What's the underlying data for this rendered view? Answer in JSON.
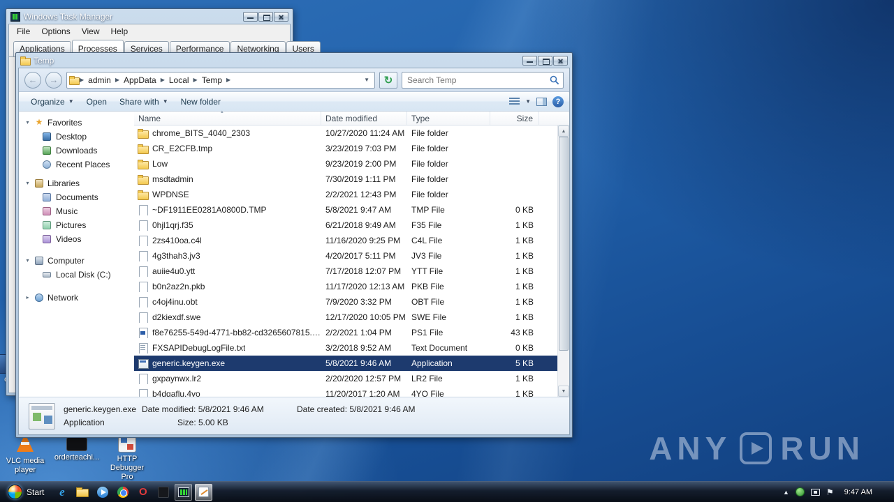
{
  "task_manager": {
    "title": "Windows Task Manager",
    "menu": [
      "File",
      "Options",
      "View",
      "Help"
    ],
    "tabs": [
      "Applications",
      "Processes",
      "Services",
      "Performance",
      "Networking",
      "Users"
    ],
    "active_tab": "Processes"
  },
  "explorer": {
    "title": "Temp",
    "breadcrumb": [
      "admin",
      "AppData",
      "Local",
      "Temp"
    ],
    "search_placeholder": "Search Temp",
    "toolbar": {
      "organize": "Organize",
      "open": "Open",
      "share": "Share with",
      "new_folder": "New folder"
    },
    "sidebar": [
      {
        "section": "Favorites",
        "items": [
          "Desktop",
          "Downloads",
          "Recent Places"
        ]
      },
      {
        "section": "Libraries",
        "items": [
          "Documents",
          "Music",
          "Pictures",
          "Videos"
        ]
      },
      {
        "section": "Computer",
        "items": [
          "Local Disk (C:)"
        ]
      },
      {
        "section": "Network",
        "items": []
      }
    ],
    "columns": [
      "Name",
      "Date modified",
      "Type",
      "Size"
    ],
    "files": [
      {
        "name": "chrome_BITS_4040_2303",
        "date": "10/27/2020 11:24 AM",
        "type": "File folder",
        "size": "",
        "icon": "folder"
      },
      {
        "name": "CR_E2CFB.tmp",
        "date": "3/23/2019 7:03 PM",
        "type": "File folder",
        "size": "",
        "icon": "folder"
      },
      {
        "name": "Low",
        "date": "9/23/2019 2:00 PM",
        "type": "File folder",
        "size": "",
        "icon": "folder"
      },
      {
        "name": "msdtadmin",
        "date": "7/30/2019 1:11 PM",
        "type": "File folder",
        "size": "",
        "icon": "folder"
      },
      {
        "name": "WPDNSE",
        "date": "2/2/2021 12:43 PM",
        "type": "File folder",
        "size": "",
        "icon": "folder"
      },
      {
        "name": "~DF1911EE0281A0800D.TMP",
        "date": "5/8/2021 9:47 AM",
        "type": "TMP File",
        "size": "0 KB",
        "icon": "file"
      },
      {
        "name": "0hjl1qrj.f35",
        "date": "6/21/2018 9:49 AM",
        "type": "F35 File",
        "size": "1 KB",
        "icon": "file"
      },
      {
        "name": "2zs410oa.c4l",
        "date": "11/16/2020 9:25 PM",
        "type": "C4L File",
        "size": "1 KB",
        "icon": "file"
      },
      {
        "name": "4g3thah3.jv3",
        "date": "4/20/2017 5:11 PM",
        "type": "JV3 File",
        "size": "1 KB",
        "icon": "file"
      },
      {
        "name": "auiie4u0.ytt",
        "date": "7/17/2018 12:07 PM",
        "type": "YTT File",
        "size": "1 KB",
        "icon": "file"
      },
      {
        "name": "b0n2az2n.pkb",
        "date": "11/17/2020 12:13 AM",
        "type": "PKB File",
        "size": "1 KB",
        "icon": "file"
      },
      {
        "name": "c4oj4inu.obt",
        "date": "7/9/2020 3:32 PM",
        "type": "OBT File",
        "size": "1 KB",
        "icon": "file"
      },
      {
        "name": "d2kiexdf.swe",
        "date": "12/17/2020 10:05 PM",
        "type": "SWE File",
        "size": "1 KB",
        "icon": "file"
      },
      {
        "name": "f8e76255-549d-4771-bb82-cd3265607815.ps1",
        "date": "2/2/2021 1:04 PM",
        "type": "PS1 File",
        "size": "43 KB",
        "icon": "ps1"
      },
      {
        "name": "FXSAPIDebugLogFile.txt",
        "date": "3/2/2018 9:52 AM",
        "type": "Text Document",
        "size": "0 KB",
        "icon": "txt"
      },
      {
        "name": "generic.keygen.exe",
        "date": "5/8/2021 9:46 AM",
        "type": "Application",
        "size": "5 KB",
        "icon": "app",
        "selected": true
      },
      {
        "name": "gxpaynwx.lr2",
        "date": "2/20/2020 12:57 PM",
        "type": "LR2 File",
        "size": "1 KB",
        "icon": "file"
      },
      {
        "name": "b4dgaflu.4yo",
        "date": "11/20/2017 1:20 AM",
        "type": "4YO File",
        "size": "1 KB",
        "icon": "file"
      }
    ],
    "details": {
      "name": "generic.keygen.exe",
      "modified": "Date modified: 5/8/2021 9:46 AM",
      "created": "Date created: 5/8/2021 9:46 AM",
      "type": "Application",
      "size": "Size: 5.00 KB"
    }
  },
  "desktop": {
    "watermark_left": "ANY",
    "watermark_right": "RUN",
    "icons": [
      {
        "label": "C"
      },
      {
        "label": "VLC media player"
      },
      {
        "label": "orderteachi..."
      },
      {
        "label": "HTTP Debugger Pro"
      }
    ]
  },
  "taskbar": {
    "start_label": "Start",
    "clock": "9:47 AM"
  }
}
